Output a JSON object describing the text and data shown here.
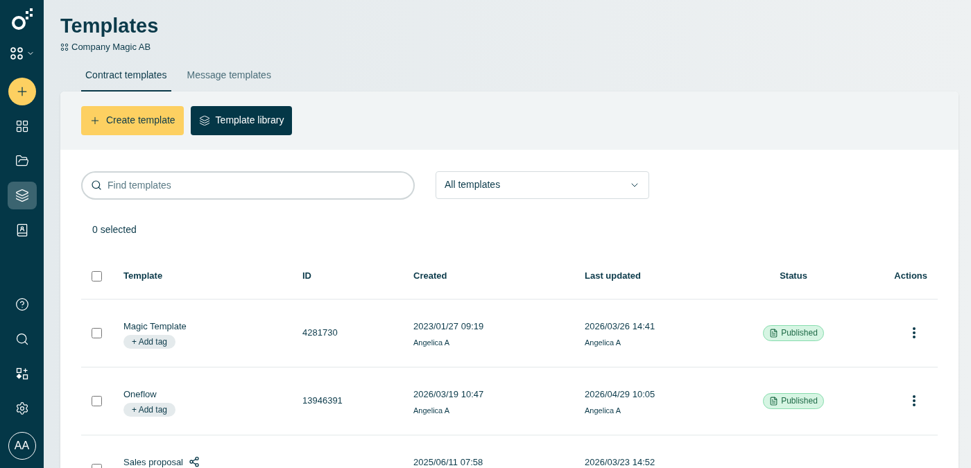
{
  "sidebar": {
    "avatar": "AA",
    "nav_top": [
      {
        "selected": false
      },
      {
        "selected": false
      },
      {
        "selected": true
      },
      {
        "selected": false
      }
    ],
    "nav_bottom": [
      {
        "selected": false
      },
      {
        "selected": false
      },
      {
        "selected": false
      },
      {
        "selected": false
      }
    ]
  },
  "header": {
    "title": "Templates",
    "workspace": "Company Magic AB"
  },
  "tabs": [
    {
      "label": "Contract templates",
      "selected": true
    },
    {
      "label": "Message templates",
      "selected": false
    }
  ],
  "toolbar": {
    "create_button": "Create template",
    "library_button": "Template library"
  },
  "search": {
    "placeholder": "Find templates"
  },
  "filter": {
    "value": "All templates"
  },
  "selection_count": "0 selected",
  "table": {
    "columns": [
      "Template",
      "ID",
      "Created",
      "Last updated",
      "Status",
      "Actions"
    ],
    "select_all_checked": false,
    "rows": [
      {
        "checked": false,
        "name": "Magic Template",
        "shared": false,
        "tag_button": "+ Add tag",
        "id": "4281730",
        "created": "2023/01/27 09:19",
        "created_by": "Angelica A",
        "updated": "2026/03/26 14:41",
        "updated_by": "Angelica A",
        "status": "Published"
      },
      {
        "checked": false,
        "name": "Oneflow",
        "shared": false,
        "tag_button": "+ Add tag",
        "id": "13946391",
        "created": "2026/03/19 10:47",
        "created_by": "Angelica A",
        "updated": "2026/04/29 10:05",
        "updated_by": "Angelica A",
        "status": "Published"
      },
      {
        "checked": false,
        "name": "Sales proposal",
        "shared": true,
        "created": "2025/06/11 07:58",
        "updated": "2026/03/23 14:52"
      }
    ]
  }
}
